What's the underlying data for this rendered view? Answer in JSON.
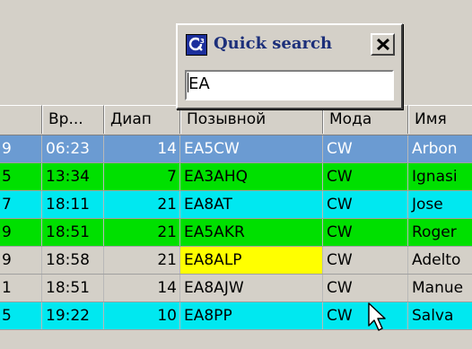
{
  "quick_search": {
    "title": "Quick search",
    "value": "EA",
    "logo_icon": "qso-logo-icon",
    "close_icon": "close-icon"
  },
  "table": {
    "columns": [
      "",
      "Вр...",
      "Диап",
      "Позывной",
      "Мода",
      "Имя"
    ],
    "rows": [
      {
        "c0": "9",
        "time": "06:23",
        "band": "14",
        "call": "EA5CW",
        "mode": "CW",
        "name": "Arbon",
        "row_color": "#6b9bd2",
        "selected": true
      },
      {
        "c0": "5",
        "time": "13:34",
        "band": "7",
        "call": "EA3AHQ",
        "mode": "CW",
        "name": "Ignasi",
        "row_color": "#00e000"
      },
      {
        "c0": "7",
        "time": "18:11",
        "band": "21",
        "call": "EA8AT",
        "mode": "CW",
        "name": "Jose",
        "row_color": "#00e8f0"
      },
      {
        "c0": "9",
        "time": "18:51",
        "band": "21",
        "call": "EA5AKR",
        "mode": "CW",
        "name": "Roger",
        "row_color": "#00e000"
      },
      {
        "c0": "9",
        "time": "18:58",
        "band": "21",
        "call": "EA8ALP",
        "mode": "CW",
        "name": "Adelto",
        "row_color": "#d4d0c8",
        "highlight_call": "#ffff00"
      },
      {
        "c0": "1",
        "time": "18:51",
        "band": "14",
        "call": "EA8AJW",
        "mode": "CW",
        "name": "Manue",
        "row_color": "#d4d0c8"
      },
      {
        "c0": "5",
        "time": "19:22",
        "band": "10",
        "call": "EA8PP",
        "mode": "CW",
        "name": "Salva",
        "row_color": "#00e8f0"
      }
    ]
  },
  "cursor_icon": "mouse-pointer-icon"
}
